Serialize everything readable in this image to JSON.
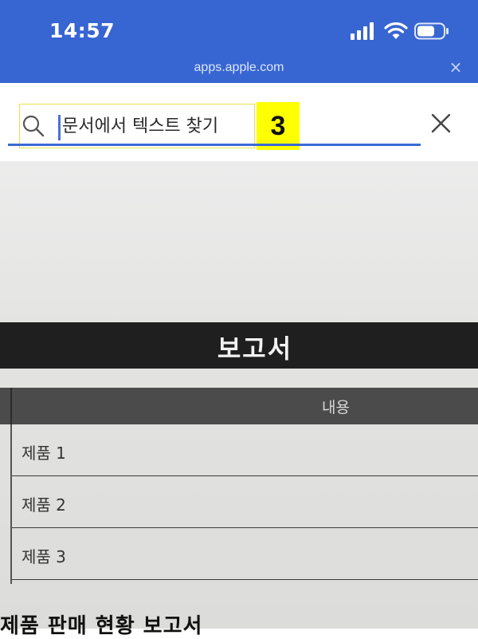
{
  "status_bar": {
    "time": "14:57",
    "url": "apps.apple.com",
    "close_glyph": "×",
    "icons": [
      "signal-icon",
      "wifi-icon",
      "battery-icon"
    ],
    "bg_color": "#3765d2"
  },
  "search": {
    "placeholder": "문서에서 텍스트 찾기",
    "value": "",
    "annotation_number": "3",
    "icons": [
      "search-icon",
      "close-icon"
    ],
    "accent_color": "#3b6ad4"
  },
  "document": {
    "title": "보고서",
    "table": {
      "column_header": "내용",
      "rows": [
        "제품 1",
        "제품 2",
        "제품 3"
      ]
    },
    "subheading": "제품 판매 현황 보고서"
  }
}
